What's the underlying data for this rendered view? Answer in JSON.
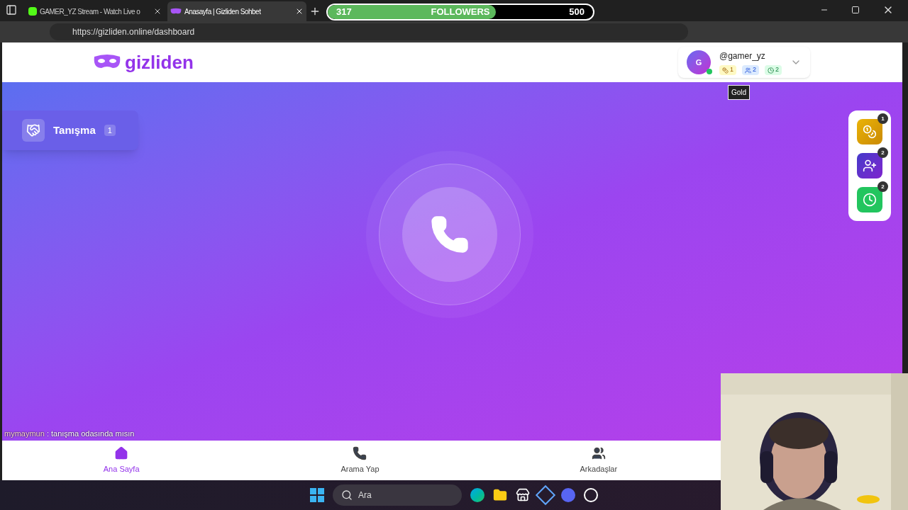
{
  "browser": {
    "tabs": [
      {
        "title": "GAMER_YZ Stream - Watch Live o",
        "selected": false,
        "kind": "stream"
      },
      {
        "title": "Anasayfa | Gizliden Sohbet",
        "selected": true,
        "kind": "mask"
      }
    ],
    "address": "https://gizliden.online/dashboard"
  },
  "followers_goal": {
    "current": "317",
    "label": "FOLLOWERS",
    "target": "500",
    "level": 0.634
  },
  "header": {
    "logo": "gizliden",
    "user": {
      "avatar": "G",
      "online": true,
      "name": "@gamer_yz",
      "stats": [
        {
          "kind": "gold",
          "count": "1"
        },
        {
          "kind": "friends",
          "count": "2"
        },
        {
          "kind": "calls",
          "count": "2"
        }
      ]
    },
    "tooltip": "Gold"
  },
  "sidebar": {
    "items": [
      {
        "label": "Tanışma",
        "count": "1"
      }
    ]
  },
  "quick_actions": [
    {
      "kind": "gold",
      "count": "1"
    },
    {
      "kind": "friends",
      "count": "2"
    },
    {
      "kind": "calls",
      "count": "2"
    }
  ],
  "bottom_nav": [
    {
      "kind": "home",
      "label": "Ana Sayfa",
      "selected": true
    },
    {
      "kind": "call",
      "label": "Arama Yap",
      "selected": false
    },
    {
      "kind": "friends",
      "label": "Arkadaşlar",
      "selected": false
    }
  ],
  "chat_overlay": {
    "user": "mymaymun",
    "message": " : tanışma odasında mısın"
  },
  "taskbar": {
    "search_placeholder": "Ara"
  }
}
